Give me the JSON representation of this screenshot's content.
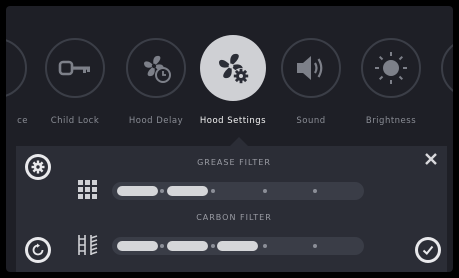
{
  "carousel": {
    "items": [
      {
        "label": "ce",
        "icon": "partial-icon"
      },
      {
        "label": "Child Lock",
        "icon": "key-icon"
      },
      {
        "label": "Hood Delay",
        "icon": "fan-timer-icon"
      },
      {
        "label": "Hood Settings",
        "icon": "fan-gear-icon",
        "active": true
      },
      {
        "label": "Sound",
        "icon": "speaker-icon"
      },
      {
        "label": "Brightness",
        "icon": "sun-icon"
      }
    ]
  },
  "panel": {
    "grease_filter": {
      "title": "GREASE FILTER",
      "level_segments": 2,
      "total_segments": 5
    },
    "carbon_filter": {
      "title": "CARBON FILTER",
      "level_segments": 3,
      "total_segments": 5
    },
    "close_icon": "close-icon",
    "settings_icon": "gear-icon",
    "reset_icon": "reset-icon",
    "confirm_icon": "check-icon"
  },
  "colors": {
    "background": "#1e1f26",
    "panel": "#2b2d36",
    "active_circle": "#cfd0d4",
    "bar_fill": "#d5d6d9"
  }
}
